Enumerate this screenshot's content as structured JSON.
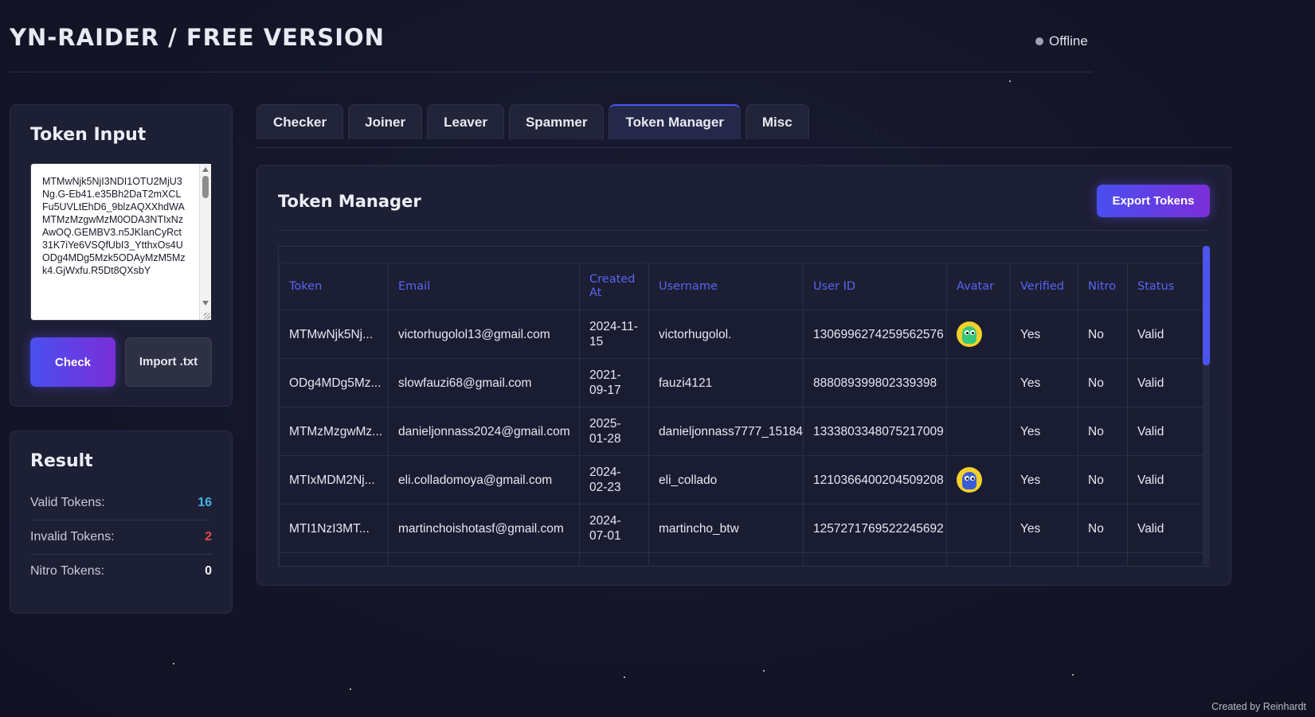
{
  "app": {
    "title": "YN-RAIDER / FREE VERSION",
    "status": "Offline"
  },
  "token_input": {
    "title": "Token Input",
    "textarea_value": "MTMwNjk5NjI3NDI1OTU2MjU3Ng.G-Eb41.e35Bh2DaT2mXCLFu5UVLtEhD6_9blzAQXXhdWA\nMTMzMzgwMzM0ODA3NTIxNzAwOQ.GEMBV3.n5JKlanCyRct31K7iYe6VSQfUbI3_YtthxOs4U\nODg4MDg5Mzk5ODAyMzM5Mzk4.GjWxfu.R5Dt8QXsbY",
    "check_label": "Check",
    "import_label": "Import .txt"
  },
  "result": {
    "title": "Result",
    "rows": [
      {
        "label": "Valid Tokens:",
        "value": "16"
      },
      {
        "label": "Invalid Tokens:",
        "value": "2"
      },
      {
        "label": "Nitro Tokens:",
        "value": "0"
      }
    ]
  },
  "tabs": [
    {
      "label": "Checker",
      "active": false
    },
    {
      "label": "Joiner",
      "active": false
    },
    {
      "label": "Leaver",
      "active": false
    },
    {
      "label": "Spammer",
      "active": false
    },
    {
      "label": "Token Manager",
      "active": true
    },
    {
      "label": "Misc",
      "active": false
    }
  ],
  "token_manager": {
    "title": "Token Manager",
    "export_label": "Export Tokens",
    "columns": [
      "Token",
      "Email",
      "Created At",
      "Username",
      "User ID",
      "Avatar",
      "Verified",
      "Nitro",
      "Status"
    ],
    "rows": [
      {
        "token": "MTMwNjk5Nj...",
        "email": "victorhugolol13@gmail.com",
        "created": "2024-11-15",
        "username": "victorhugolol.",
        "user_id": "1306996274259562576",
        "avatar": "green-monster",
        "verified": "Yes",
        "nitro": "No",
        "status": "Valid"
      },
      {
        "token": "ODg4MDg5Mz...",
        "email": "slowfauzi68@gmail.com",
        "created": "2021-09-17",
        "username": "fauzi4121",
        "user_id": "888089399802339398",
        "avatar": "",
        "verified": "Yes",
        "nitro": "No",
        "status": "Valid"
      },
      {
        "token": "MTMzMzgwMz...",
        "email": "danieljonnass2024@gmail.com",
        "created": "2025-01-28",
        "username": "danieljonnass7777_15184",
        "user_id": "1333803348075217009",
        "avatar": "",
        "verified": "Yes",
        "nitro": "No",
        "status": "Valid"
      },
      {
        "token": "MTIxMDM2Nj...",
        "email": "eli.colladomoya@gmail.com",
        "created": "2024-02-23",
        "username": "eli_collado",
        "user_id": "1210366400204509208",
        "avatar": "blue-monster",
        "verified": "Yes",
        "nitro": "No",
        "status": "Valid"
      },
      {
        "token": "MTI1NzI3MT...",
        "email": "martinchoishotasf@gmail.com",
        "created": "2024-07-01",
        "username": "martincho_btw",
        "user_id": "1257271769522245692",
        "avatar": "",
        "verified": "Yes",
        "nitro": "No",
        "status": "Valid"
      }
    ]
  },
  "footer": "Created by Reinhardt",
  "colors": {
    "accent": "#4a55f0",
    "accent_gradient_end": "#7a2ed8",
    "valid": "#3fb6ea",
    "invalid": "#e24b4b",
    "background": "#14152a"
  }
}
